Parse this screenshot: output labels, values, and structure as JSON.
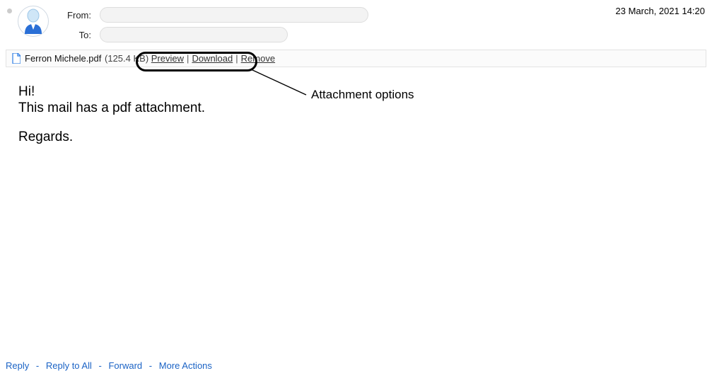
{
  "header": {
    "from_label": "From:",
    "to_label": "To:",
    "date": "23 March, 2021 14:20"
  },
  "attachment": {
    "filename": "Ferron Michele.pdf",
    "size": "(125.4 KB)",
    "preview": "Preview",
    "download": "Download",
    "remove": "Remove",
    "separator": "|"
  },
  "annotation": {
    "label": "Attachment options"
  },
  "body": {
    "line1": "Hi!",
    "line2": "This mail has a pdf attachment.",
    "line3": "Regards."
  },
  "actions": {
    "reply": "Reply",
    "reply_all": "Reply to All",
    "forward": "Forward",
    "more": "More Actions",
    "dash": "-"
  }
}
